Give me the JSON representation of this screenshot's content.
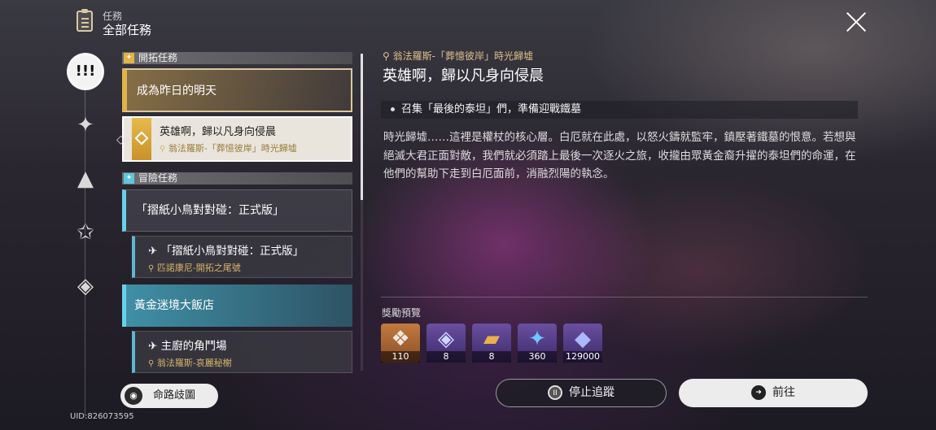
{
  "header": {
    "category": "任務",
    "title": "全部任務"
  },
  "sections": {
    "trailblaze": "開拓任務",
    "adventure": "冒險任務"
  },
  "quests": {
    "q1": {
      "title": "成為昨日的明天"
    },
    "q2": {
      "title": "英雄啊，歸以凡身向侵晨",
      "location": "翁法羅斯-「葬憶彼岸」時光歸墟"
    },
    "q3": {
      "title": "「摺紙小鳥對對碰：正式版」"
    },
    "q4": {
      "title": "「摺紙小鳥對對碰：正式版」",
      "location": "匹諾康尼-開拓之尾號"
    },
    "q5": {
      "title": "黃金迷境大飯店"
    },
    "q6": {
      "title": "主廚的角鬥場",
      "location": "翁法羅斯-哀麗秘榭"
    }
  },
  "left_button": "命路歧圖",
  "uid": "UID:826073595",
  "detail": {
    "location": "翁法羅斯-「葬憶彼岸」時光歸墟",
    "title": "英雄啊，歸以凡身向侵晨",
    "objective": "召集「最後的泰坦」們，準備迎戰鐵墓",
    "description": "時光歸墟……這裡是權杖的核心層。白厄就在此處，以怒火鑄就監牢，鎮壓著鐵墓的恨意。若想與絕滅大君正面對敵，我們就必須踏上最後一次逐火之旅，收攏由眾黃金裔升擢的泰坦們的命運，在他們的幫助下走到白厄面前，消融烈陽的執念。",
    "reward_label": "獎勵預覽",
    "rewards": [
      {
        "qty": "110",
        "icon": "crystal-icon"
      },
      {
        "qty": "8",
        "icon": "star-rail-pass-icon"
      },
      {
        "qty": "8",
        "icon": "book-icon"
      },
      {
        "qty": "360",
        "icon": "blue-crystal-icon"
      },
      {
        "qty": "129000",
        "icon": "credit-icon"
      }
    ]
  },
  "buttons": {
    "stop": "停止追蹤",
    "go": "前往"
  }
}
